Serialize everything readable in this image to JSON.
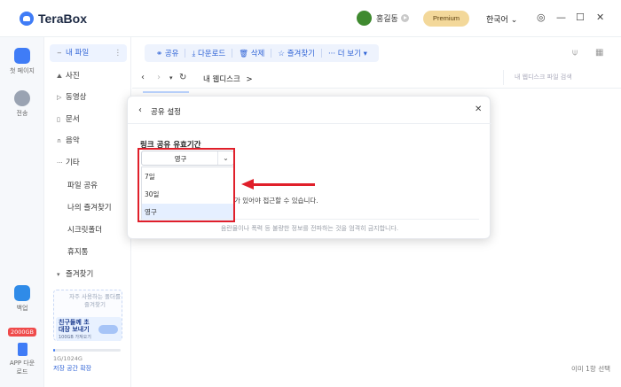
{
  "app": {
    "name": "TeraBox",
    "user_name": "홍길동",
    "premium_label": "Premium",
    "language": "한국어",
    "language_caret": "⌄",
    "settings_glyph": "◎",
    "minimize_glyph": "—",
    "maximize_glyph": "☐",
    "close_glyph": "✕"
  },
  "colors": {
    "accent": "#3f7cf6",
    "annotation": "#e01f2a",
    "premium_bg": "#f3d89a"
  },
  "rail": {
    "home_label": "첫 페이지",
    "transfer_label": "전송",
    "backup_label": "백업",
    "badge_label": "2000GB",
    "app_download_label_line1": "APP 다운",
    "app_download_label_line2": "로드"
  },
  "nav": {
    "my_files": "내 파일",
    "more_glyph": "⋮",
    "photos": "사진",
    "videos": "동영상",
    "documents": "문서",
    "music": "음악",
    "others": "기타",
    "file_share": "파일 공유",
    "my_favorites": "나의 즐겨찾기",
    "secret_folder": "시크릿폴더",
    "trash": "휴지통",
    "favorites": "즐겨찾기",
    "promo_hint": "자주 사용하는 폴더를 즐겨찾기",
    "promo_title": "친구들께 초대장 보내기",
    "promo_sub": "100GB 가져오기",
    "storage_used": "1G/1024G",
    "storage_fraction": 0.001,
    "storage_link": "저장 공간 확장"
  },
  "toolbar": {
    "share": "공유",
    "download": "다운로드",
    "delete": "삭제",
    "favorite": "즐겨찾기",
    "more": "더 보기"
  },
  "path": {
    "back_glyph": "‹",
    "forward_glyph": "›",
    "history_glyph": "▾",
    "refresh_glyph": "↻",
    "current": "내 웹디스크",
    "separator": ">",
    "search_placeholder": "내 웹디스크 파일 검색"
  },
  "status": {
    "selection_text": "이미 1항 선택"
  },
  "dialog": {
    "back_glyph": "‹",
    "title": "공유 설정",
    "close_glyph": "✕",
    "label": "링크 공유 유효기간",
    "selected_value": "영구",
    "options": [
      "7일",
      "30일",
      "영구"
    ],
    "note": "가 있어야 접근할 수 있습니다.",
    "footer": "음란물이나 폭력 등 불량한 정보를 전파하는 것을 엄격히 금지합니다."
  }
}
